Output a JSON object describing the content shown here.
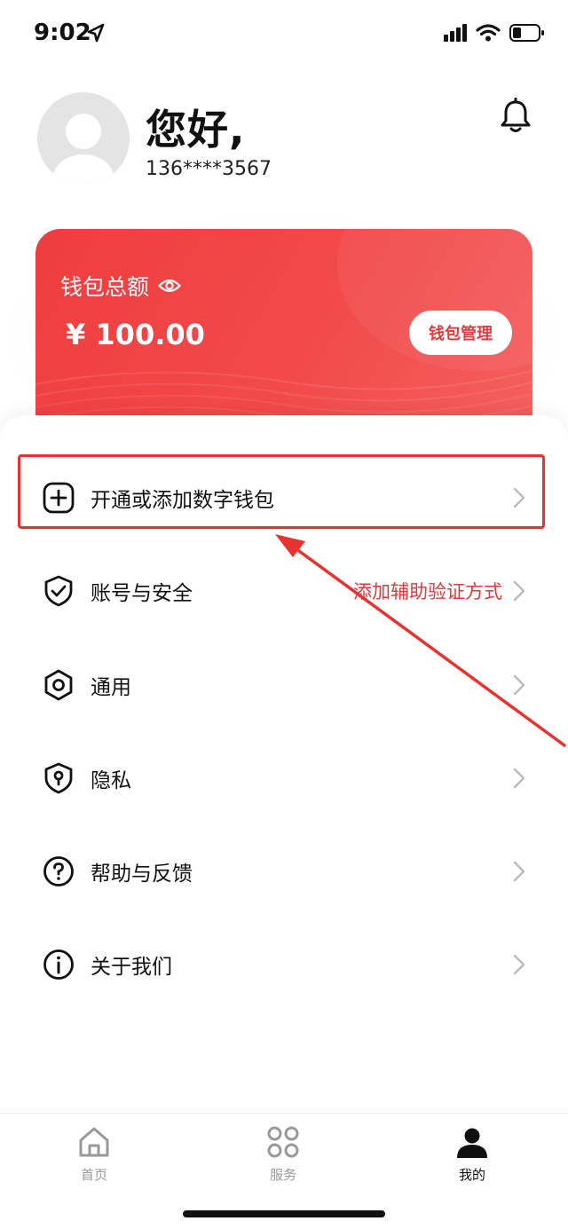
{
  "status_bar": {
    "time": "9:02",
    "icons": [
      "location-arrow-icon",
      "signal-icon",
      "wifi-icon",
      "battery-icon"
    ]
  },
  "header": {
    "greeting": "您好,",
    "phone": "136****3567",
    "avatar_icon": "default-avatar-icon",
    "notification_icon": "bell-icon"
  },
  "wallet": {
    "label": "钱包总额",
    "visibility_icon": "eye-icon",
    "amount": "¥ 100.00",
    "manage_button": "钱包管理",
    "colors": {
      "card_start": "#ef3d3f",
      "card_end": "#f4605f",
      "button_text": "#e33b3d"
    }
  },
  "menu": {
    "items": [
      {
        "icon": "plus-square-icon",
        "label": "开通或添加数字钱包",
        "hint": ""
      },
      {
        "icon": "shield-check-icon",
        "label": "账号与安全",
        "hint": "添加辅助验证方式"
      },
      {
        "icon": "hexagon-settings-icon",
        "label": "通用",
        "hint": ""
      },
      {
        "icon": "shield-lock-icon",
        "label": "隐私",
        "hint": ""
      },
      {
        "icon": "question-circle-icon",
        "label": "帮助与反馈",
        "hint": ""
      },
      {
        "icon": "info-circle-icon",
        "label": "关于我们",
        "hint": ""
      }
    ],
    "hint_color": "#e03a3c",
    "annotation_color": "#e8322f"
  },
  "tabbar": {
    "tabs": [
      {
        "icon": "home-icon",
        "label": "首页",
        "active": false
      },
      {
        "icon": "grid-services-icon",
        "label": "服务",
        "active": false
      },
      {
        "icon": "user-icon",
        "label": "我的",
        "active": true
      }
    ]
  }
}
